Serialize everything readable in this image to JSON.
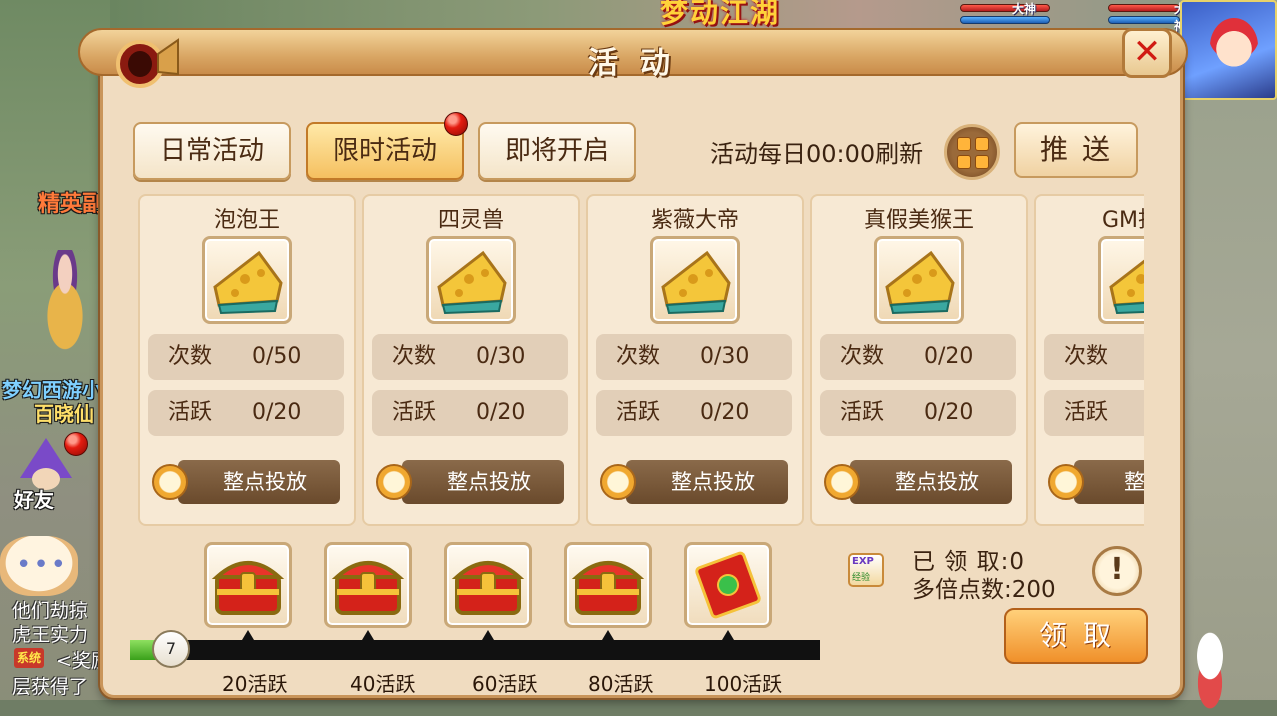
{
  "background": {
    "banner_title": "梦动江湖",
    "god_tag": "大神",
    "elite_text": "精英副",
    "game_name": "梦幻西游小",
    "npc_name": "百晓仙",
    "friend_label": "好友",
    "chat_lines": [
      "他们劫掠",
      "虎王实力",
      "<奖励",
      "层获得了"
    ],
    "system_badge": "系统"
  },
  "dialog": {
    "title": "活动",
    "close_icon": "close-x-icon"
  },
  "tabs": [
    {
      "label": "日常活动",
      "active": false
    },
    {
      "label": "限时活动",
      "active": true,
      "badge": true
    },
    {
      "label": "即将开启",
      "active": false
    }
  ],
  "refresh_text": "活动每日00:00刷新",
  "push_label": "推送",
  "cards": [
    {
      "name": "泡泡王",
      "count_label": "次数",
      "count": "0/50",
      "active_label": "活跃",
      "active": "0/20",
      "button": "整点投放",
      "icon": "cheese-item-icon"
    },
    {
      "name": "四灵兽",
      "count_label": "次数",
      "count": "0/30",
      "active_label": "活跃",
      "active": "0/20",
      "button": "整点投放",
      "icon": "cheese-item-icon"
    },
    {
      "name": "紫薇大帝",
      "count_label": "次数",
      "count": "0/30",
      "active_label": "活跃",
      "active": "0/20",
      "button": "整点投放",
      "icon": "cheese-item-icon"
    },
    {
      "name": "真假美猴王",
      "count_label": "次数",
      "count": "0/20",
      "active_label": "活跃",
      "active": "0/20",
      "button": "整点投放",
      "icon": "cheese-item-icon"
    },
    {
      "name": "GM找",
      "count_label": "次数",
      "count": "",
      "active_label": "活跃",
      "active": "",
      "button": "整点",
      "icon": "cheese-item-icon"
    }
  ],
  "rewards": {
    "current_level": "7",
    "progress_fraction": 0.07,
    "milestones": [
      {
        "label": "20活跃",
        "icon": "treasure-chest-icon"
      },
      {
        "label": "40活跃",
        "icon": "treasure-chest-icon"
      },
      {
        "label": "60活跃",
        "icon": "treasure-chest-icon"
      },
      {
        "label": "80活跃",
        "icon": "treasure-chest-icon"
      },
      {
        "label": "100活跃",
        "icon": "red-envelope-icon"
      }
    ],
    "exp_label": "EXP",
    "exp_sub": "经验",
    "claimed_text": "已 领 取:0",
    "multiplier_text": "多倍点数:200",
    "claim_button": "领取"
  },
  "colors": {
    "panel_bg": "#f0dcc0",
    "active_tab": "#f5c060",
    "claim_button": "#f0902a",
    "progress_fill": "#3aa01a",
    "close_x": "#d01a12"
  }
}
